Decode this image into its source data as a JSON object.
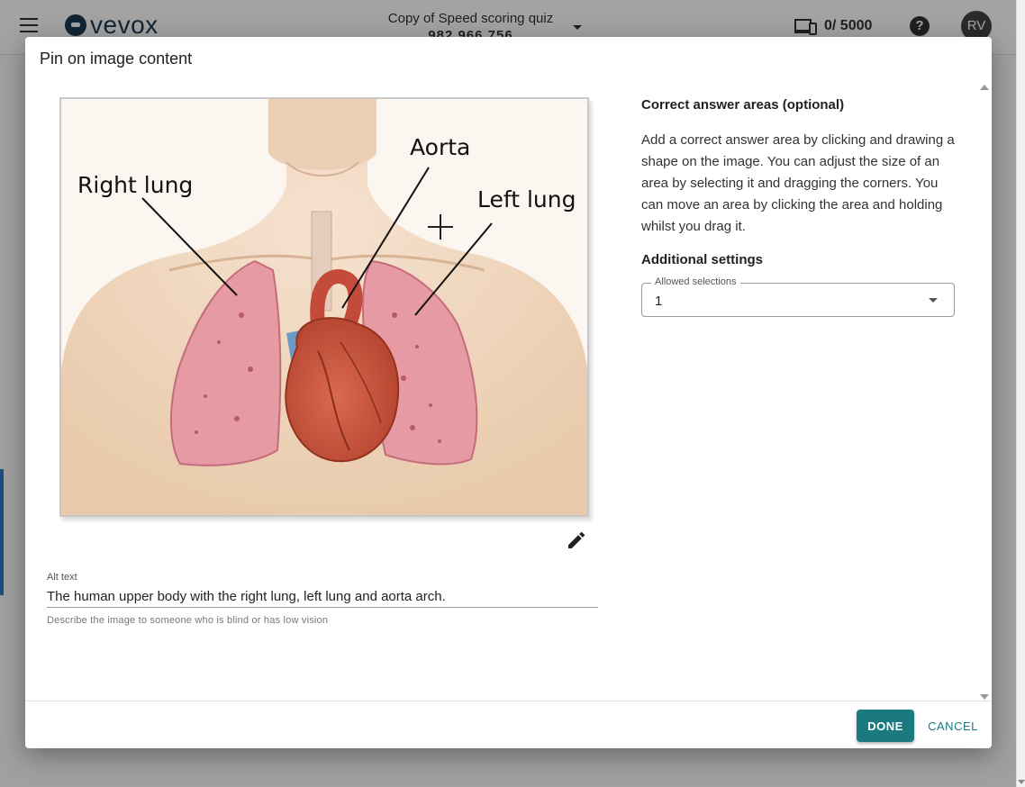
{
  "app": {
    "logo_text": "vevox",
    "session_title": "Copy of Speed scoring quiz",
    "session_id": "982 966 756",
    "participants": "0/ 5000",
    "help": "?",
    "avatar_initials": "RV"
  },
  "dialog": {
    "title": "Pin on image content",
    "image": {
      "labels": {
        "right_lung": "Right lung",
        "aorta": "Aorta",
        "left_lung": "Left lung"
      }
    },
    "alt_text": {
      "label": "Alt text",
      "value": "The human upper body with the right lung, left lung and aorta arch.",
      "hint": "Describe the image to someone who is blind or has low vision"
    },
    "correct_areas": {
      "heading": "Correct answer areas (optional)",
      "description": "Add a correct answer area by clicking and drawing a shape on the image. You can adjust the size of an area by selecting it and dragging the corners. You can move an area by clicking the area and holding whilst you drag it."
    },
    "additional_settings": {
      "heading": "Additional settings",
      "allowed_selections_label": "Allowed selections",
      "allowed_selections_value": "1"
    },
    "footer": {
      "done_label": "DONE",
      "cancel_label": "CANCEL"
    }
  },
  "colors": {
    "accent": "#1a7a7f",
    "lung": "#e69aa4",
    "heart": "#c7553f"
  },
  "icons": [
    "menu-icon",
    "devices-icon",
    "help-icon",
    "edit-pencil-icon",
    "crosshair-cursor-icon"
  ]
}
